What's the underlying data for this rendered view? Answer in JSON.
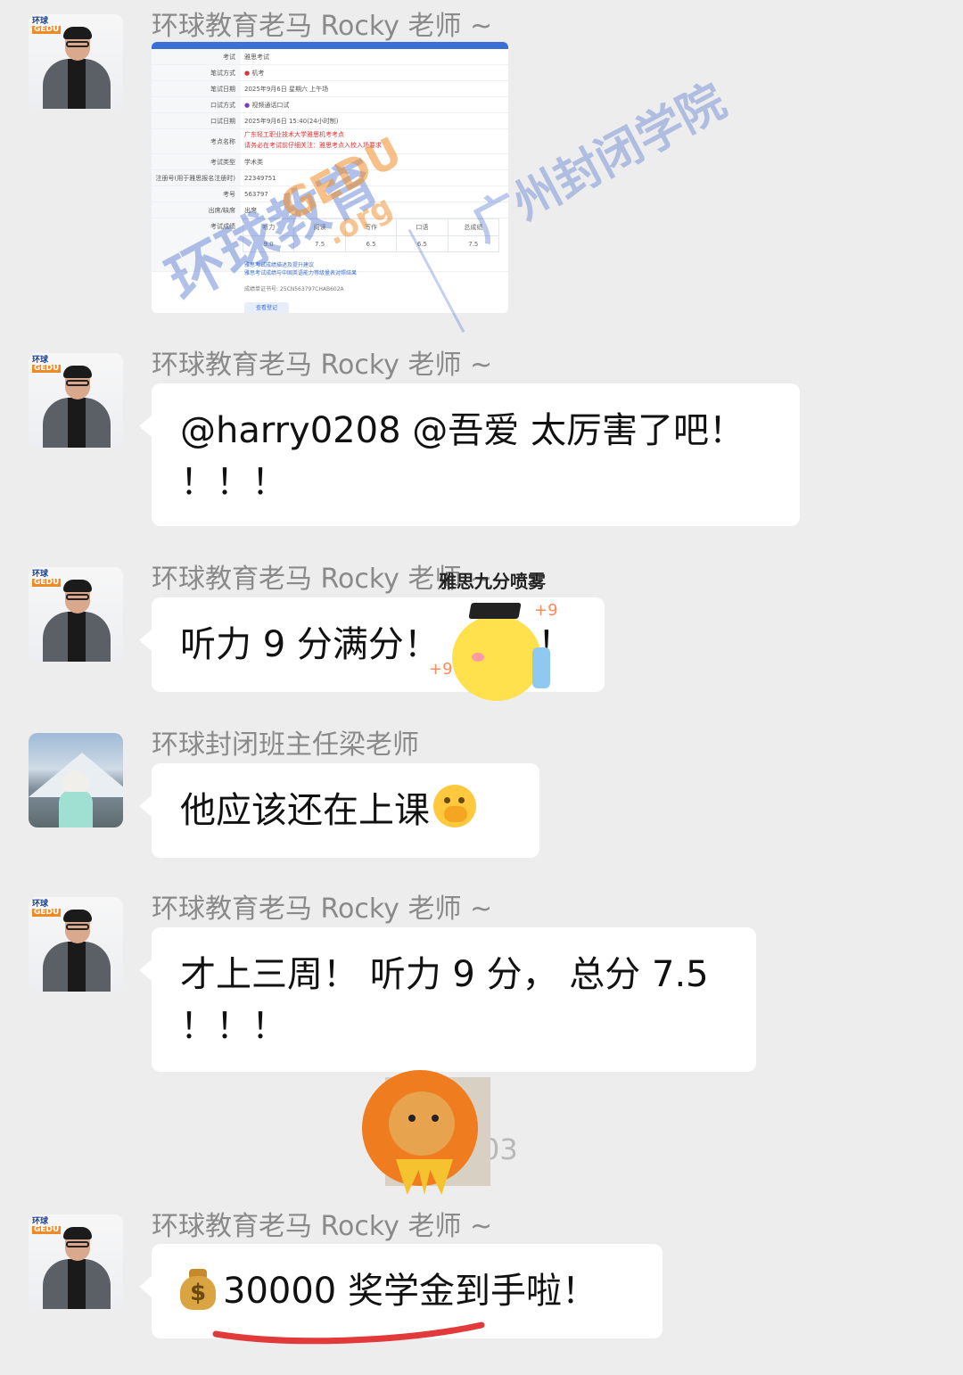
{
  "messages": [
    {
      "sender": "环球教育老马 Rocky 老师 ~",
      "type": "image-card"
    },
    {
      "sender": "环球教育老马 Rocky 老师 ~",
      "text_line1": "@harry0208 @吾爱 太厉害了吧！",
      "text_line2": "！！！"
    },
    {
      "sender": "环球教育老马 Rocky 老师 ~",
      "text_a": "听力 9 分满分！",
      "text_b": "！"
    },
    {
      "sender": "环球封闭班主任梁老师",
      "text": "他应该还在上课"
    },
    {
      "sender": "环球教育老马 Rocky 老师 ~",
      "text_line1": "才上三周！ 听力 9 分， 总分 7.5",
      "text_line2": "！！！"
    },
    {
      "sender": "环球教育老马 Rocky 老师 ~",
      "text": "30000 奖学金到手啦！"
    }
  ],
  "card": {
    "rows": [
      {
        "k": "考试",
        "v": "雅思考试"
      },
      {
        "k": "笔试方式",
        "v": "机考"
      },
      {
        "k": "笔试日期",
        "v": "2025年9月6日 星期六 上午场"
      },
      {
        "k": "口试方式",
        "v": "视频通话口试"
      },
      {
        "k": "口试日期",
        "v": "2025年9月6日 15:40(24小时制)"
      },
      {
        "k": "考点名称",
        "v": "广东轻工职业技术大学雅思机考考点",
        "v2": "请务必在考试前仔细关注：雅思考点入校入场要求"
      },
      {
        "k": "考试类型",
        "v": "学术类"
      },
      {
        "k": "注册号(用于雅思报名注册时)",
        "v": "22349751"
      },
      {
        "k": "考号",
        "v": "563797"
      },
      {
        "k": "出席/缺席",
        "v": "出席"
      },
      {
        "k": "考试成绩",
        "v": ""
      }
    ],
    "score_headers": [
      "听力",
      "阅读",
      "写作",
      "口语",
      "总成绩"
    ],
    "score_values": [
      "9.0",
      "7.5",
      "6.5",
      "6.5",
      "7.5"
    ],
    "link1": "雅思考试成绩描述及提升建议",
    "link2": "雅思考试成绩与中国英语能力等级量表对照结果",
    "cert": "成绩单证书号: 25CN563797CHAB602A",
    "button": "查看登记"
  },
  "watermark": {
    "brand_zh": "环球教育",
    "brand_en": "GEDU",
    "brand_org": ".org",
    "school": "广州封闭学院"
  },
  "sticker": {
    "caption": "雅思九分喷雾",
    "plus": "+9"
  },
  "timestamp": "03",
  "colors": {
    "background": "#ededed",
    "bubble": "#ffffff",
    "sender": "#8a8a8a",
    "underline": "#e23a3a"
  }
}
